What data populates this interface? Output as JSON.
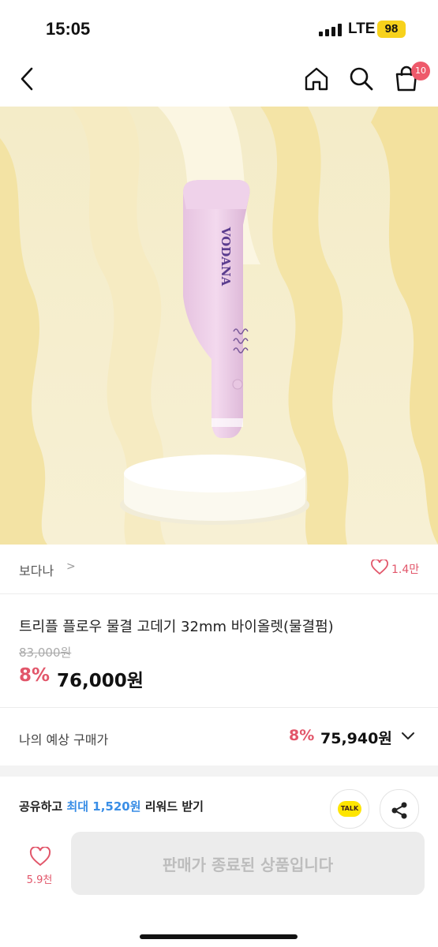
{
  "status_bar": {
    "time": "15:05",
    "network": "LTE",
    "battery": "98"
  },
  "nav": {
    "cart_count": "10",
    "icons": [
      "back-icon",
      "home-icon",
      "search-icon",
      "cart-icon"
    ]
  },
  "product_image": {
    "brand_mark": "VODANA"
  },
  "brand": {
    "name": "보다나",
    "chevron": ">",
    "likes": "1.4만"
  },
  "product": {
    "title": "트리플 플로우 물결 고데기 32mm 바이올렛(물결펌)",
    "original_price": "83,000원",
    "discount": "8%",
    "price": "76,000원"
  },
  "expected_price": {
    "label": "나의 예상 구매가",
    "discount": "8%",
    "price": "75,940원"
  },
  "share": {
    "prefix": "공유하고 ",
    "highlight": "최대 1,520원",
    "suffix": " 리워드 받기",
    "talk_label": "TALK"
  },
  "bottom_bar": {
    "likes": "5.9천",
    "sold_out_label": "판매가 종료된 상품입니다"
  },
  "colors": {
    "accent": "#e2566a",
    "link": "#3a8ee6",
    "kakao": "#fee500",
    "battery": "#f7d21c"
  }
}
